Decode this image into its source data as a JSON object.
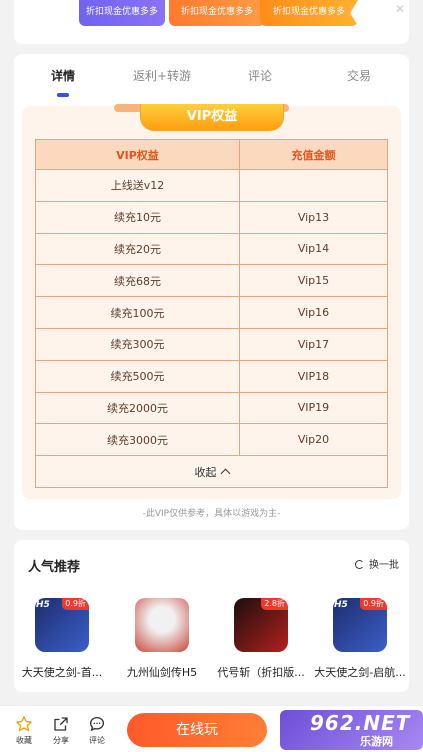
{
  "promos": [
    "折扣现金优惠多多",
    "折扣现金优惠多多",
    "折扣现金优惠多多"
  ],
  "tabs": [
    {
      "label": "详情",
      "active": true
    },
    {
      "label": "返利+转游",
      "active": false
    },
    {
      "label": "评论",
      "active": false
    },
    {
      "label": "交易",
      "active": false
    }
  ],
  "vip": {
    "title": "VIP权益",
    "headers": [
      "VIP权益",
      "充值金额"
    ],
    "rows": [
      [
        "上线送v12",
        ""
      ],
      [
        "续充10元",
        "Vip13"
      ],
      [
        "续充20元",
        "Vip14"
      ],
      [
        "续充68元",
        "Vip15"
      ],
      [
        "续充100元",
        "Vip16"
      ],
      [
        "续充300元",
        "Vip17"
      ],
      [
        "续充500元",
        "VIP18"
      ],
      [
        "续充2000元",
        "VIP19"
      ],
      [
        "续充3000元",
        "Vip20"
      ]
    ],
    "collapse_label": "收起",
    "disclaimer": "-此VIP仅供参考，具体以游戏为主-"
  },
  "recommend": {
    "title": "人气推荐",
    "refresh_label": "换一批",
    "games": [
      {
        "name": "大天使之剑-首...",
        "badge": "0.9折",
        "h5": "H5",
        "colors": [
          "#1d2d6e",
          "#3b5fc9"
        ]
      },
      {
        "name": "九州仙剑传H5",
        "badge": "",
        "h5": "",
        "colors": [
          "#e9e9e9",
          "#c9453a"
        ]
      },
      {
        "name": "代号斩（折扣版...",
        "badge": "2.8折",
        "h5": "",
        "colors": [
          "#1a0f0f",
          "#b4201c"
        ]
      },
      {
        "name": "大天使之剑-启航...",
        "badge": "0.9折",
        "h5": "H5",
        "colors": [
          "#1d2d6e",
          "#3b5fc9"
        ]
      }
    ]
  },
  "bottom": {
    "favorite_label": "收藏",
    "share_label": "分享",
    "comment_label": "评论",
    "play_label": "在线玩",
    "watermark_main": "962.NET",
    "watermark_sub": "乐游网"
  }
}
